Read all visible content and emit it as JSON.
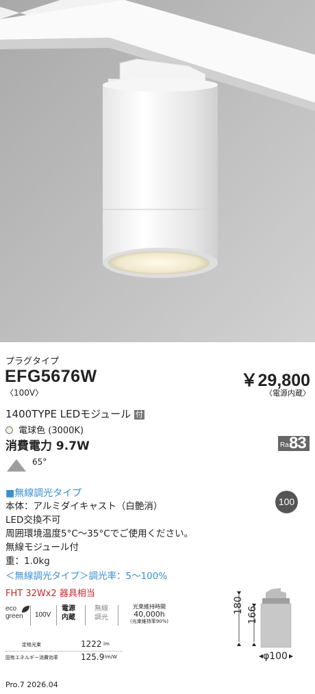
{
  "product": {
    "category": "プラグタイプ",
    "model": "EFG5676W",
    "voltage": "〈100V〉",
    "price": "￥29,800",
    "price_note": "〈電源内蔵〉",
    "type_line": "1400TYPE LEDモジュール",
    "type_tag": "付",
    "color_temp": "電球色 (3000K)",
    "power": "消費電力 9.7W",
    "ra_label": "Ra",
    "ra_value": "83",
    "beam_angle": "65°"
  },
  "features": {
    "wireless_type": "■無線調光タイプ",
    "badge": "100",
    "lines": [
      "本体：アルミダイキャスト（白艶消）",
      "LED交換不可",
      "周囲環境温度5°C〜35°Cでご使用ください。",
      "無線モジュール付",
      "重：1.0kg"
    ],
    "dimming": "＜無線調光タイプ＞調光率：5〜100%",
    "equivalent": "FHT 32Wx2 器具相当"
  },
  "icons": {
    "eco_top": "eco",
    "eco_bottom": "green",
    "voltage": "100V",
    "power_top": "電源",
    "power_bottom": "内蔵",
    "wireless_top": "無線",
    "wireless_bottom": "調光",
    "life_title": "光束維持時間",
    "life_value": "40,000h",
    "life_note": "(光束維持率90%)"
  },
  "specs": [
    {
      "label": "定格光束",
      "value": "1222",
      "unit": "lm"
    },
    {
      "label": "固有エネルギー消費効率",
      "value": "125.9",
      "unit": "lm/W"
    }
  ],
  "dimensions": {
    "h1": "180",
    "h2": "166",
    "diameter": "φ100"
  },
  "footer": "Pro.7 2026.04",
  "colors": {
    "accent_blue": "#3a8fd0",
    "accent_red": "#c62828",
    "badge_gray": "#666666"
  }
}
